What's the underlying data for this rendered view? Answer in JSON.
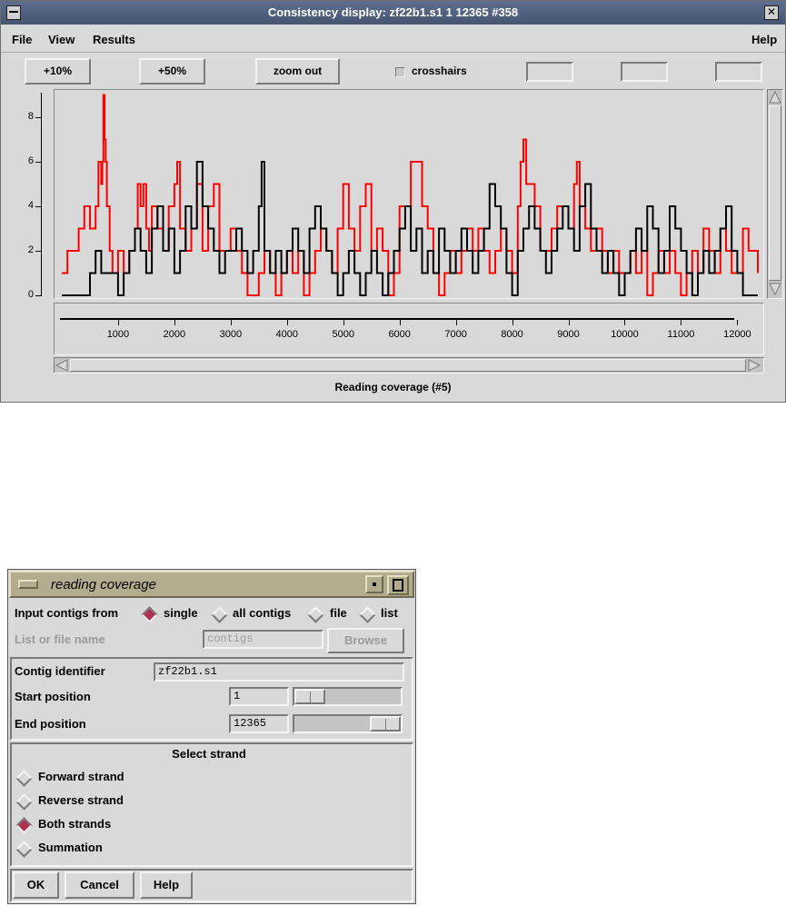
{
  "main": {
    "title": "Consistency display: zf22b1.s1 1 12365 #358",
    "menu": {
      "file": "File",
      "view": "View",
      "results": "Results",
      "help": "Help"
    },
    "toolbar": {
      "zoom10": "+10%",
      "zoom50": "+50%",
      "zoom_out": "zoom out",
      "crosshairs": "crosshairs",
      "crosshairs_checked": false
    },
    "caption": "Reading coverage (#5)"
  },
  "chart_data": {
    "type": "line",
    "title": "Reading coverage (#5)",
    "xlabel": "",
    "ylabel": "",
    "xlim": [
      0,
      12365
    ],
    "ylim": [
      0,
      9
    ],
    "y_ticks": [
      0,
      2,
      4,
      6,
      8
    ],
    "x_ticks": [
      1000,
      2000,
      3000,
      4000,
      5000,
      6000,
      7000,
      8000,
      9000,
      10000,
      11000,
      12000
    ],
    "colors": {
      "forward": "#ff0000",
      "reverse": "#000000"
    },
    "series": [
      {
        "color": "#ff0000",
        "x": [
          0,
          100,
          200,
          300,
          400,
          500,
          600,
          650,
          700,
          720,
          740,
          760,
          780,
          800,
          850,
          900,
          1000,
          1100,
          1200,
          1300,
          1350,
          1400,
          1450,
          1500,
          1550,
          1600,
          1700,
          1800,
          1900,
          2000,
          2050,
          2100,
          2200,
          2300,
          2400,
          2500,
          2600,
          2700,
          2800,
          2900,
          3000,
          3100,
          3200,
          3300,
          3400,
          3500,
          3600,
          3700,
          3800,
          3900,
          4000,
          4100,
          4200,
          4300,
          4400,
          4500,
          4600,
          4700,
          4800,
          4900,
          5000,
          5100,
          5200,
          5300,
          5400,
          5500,
          5600,
          5700,
          5800,
          5900,
          6000,
          6100,
          6200,
          6300,
          6400,
          6500,
          6600,
          6700,
          6800,
          6900,
          7000,
          7100,
          7200,
          7300,
          7400,
          7500,
          7600,
          7700,
          7800,
          7900,
          8000,
          8100,
          8150,
          8200,
          8250,
          8300,
          8400,
          8500,
          8600,
          8700,
          8800,
          8900,
          9000,
          9100,
          9150,
          9200,
          9300,
          9400,
          9500,
          9600,
          9700,
          9800,
          9900,
          10000,
          10100,
          10200,
          10300,
          10400,
          10500,
          10600,
          10700,
          10800,
          10900,
          11000,
          11100,
          11200,
          11300,
          11400,
          11500,
          11600,
          11700,
          11800,
          11900,
          12000,
          12100,
          12200,
          12365
        ],
        "y": [
          1,
          2,
          2,
          3,
          4,
          3,
          4,
          6,
          5,
          6,
          9,
          7,
          6,
          4,
          2,
          1,
          2,
          1,
          2,
          3,
          5,
          4,
          5,
          3,
          2,
          4,
          3,
          2,
          4,
          5,
          6,
          3,
          2,
          3,
          5,
          2,
          4,
          5,
          2,
          2,
          3,
          2,
          1,
          0,
          0,
          1,
          2,
          1,
          0,
          1,
          2,
          1,
          2,
          0,
          1,
          2,
          3,
          2,
          1,
          3,
          5,
          3,
          2,
          4,
          5,
          2,
          3,
          2,
          0,
          1,
          4,
          4,
          6,
          6,
          4,
          3,
          1,
          0,
          1,
          2,
          1,
          2,
          3,
          2,
          3,
          2,
          1,
          2,
          3,
          2,
          1,
          4,
          6,
          7,
          5,
          5,
          4,
          2,
          2,
          3,
          4,
          4,
          3,
          5,
          6,
          4,
          3,
          2,
          3,
          2,
          1,
          2,
          1,
          1,
          2,
          1,
          2,
          0,
          1,
          2,
          1,
          2,
          1,
          0,
          1,
          2,
          1,
          3,
          2,
          1,
          3,
          2,
          1,
          1,
          3,
          2,
          1
        ]
      },
      {
        "color": "#000000",
        "x": [
          0,
          100,
          200,
          300,
          400,
          500,
          600,
          700,
          800,
          900,
          1000,
          1100,
          1200,
          1300,
          1400,
          1500,
          1600,
          1700,
          1800,
          1900,
          2000,
          2100,
          2200,
          2300,
          2400,
          2500,
          2600,
          2700,
          2800,
          2900,
          3000,
          3100,
          3200,
          3300,
          3400,
          3500,
          3550,
          3600,
          3700,
          3800,
          3900,
          4000,
          4100,
          4200,
          4300,
          4400,
          4500,
          4600,
          4700,
          4800,
          4900,
          5000,
          5100,
          5200,
          5300,
          5400,
          5500,
          5600,
          5700,
          5800,
          5900,
          6000,
          6100,
          6200,
          6300,
          6400,
          6500,
          6600,
          6700,
          6800,
          6900,
          7000,
          7100,
          7200,
          7300,
          7400,
          7500,
          7600,
          7700,
          7800,
          7900,
          8000,
          8100,
          8200,
          8300,
          8400,
          8500,
          8600,
          8700,
          8800,
          8900,
          9000,
          9100,
          9200,
          9300,
          9400,
          9500,
          9600,
          9700,
          9800,
          9900,
          10000,
          10100,
          10200,
          10300,
          10400,
          10500,
          10600,
          10700,
          10800,
          10900,
          11000,
          11100,
          11200,
          11300,
          11400,
          11500,
          11600,
          11700,
          11800,
          11900,
          12000,
          12100,
          12200,
          12365
        ],
        "y": [
          0,
          0,
          0,
          0,
          0,
          1,
          2,
          1,
          1,
          1,
          0,
          1,
          2,
          3,
          2,
          1,
          3,
          4,
          2,
          3,
          1,
          2,
          4,
          3,
          6,
          4,
          3,
          2,
          1,
          2,
          2,
          3,
          2,
          1,
          2,
          4,
          6,
          2,
          1,
          2,
          1,
          2,
          3,
          2,
          1,
          3,
          4,
          3,
          2,
          1,
          0,
          1,
          2,
          1,
          0,
          1,
          2,
          1,
          0,
          1,
          2,
          3,
          4,
          2,
          3,
          1,
          2,
          1,
          3,
          2,
          1,
          2,
          3,
          2,
          1,
          2,
          3,
          5,
          4,
          3,
          1,
          0,
          2,
          3,
          4,
          3,
          2,
          1,
          2,
          3,
          4,
          3,
          2,
          4,
          5,
          3,
          2,
          1,
          2,
          1,
          0,
          1,
          2,
          3,
          2,
          4,
          3,
          1,
          2,
          4,
          3,
          2,
          1,
          0,
          1,
          2,
          1,
          2,
          3,
          4,
          2,
          1,
          0,
          0,
          0
        ]
      }
    ]
  },
  "dialog": {
    "title": "reading coverage",
    "input_label": "Input contigs from",
    "options": {
      "single": "single",
      "all": "all contigs",
      "file": "file",
      "list": "list",
      "selected": "single"
    },
    "listfile_label": "List or file name",
    "listfile_value": "contigs",
    "browse": "Browse",
    "contig_label": "Contig identifier",
    "contig_value": "zf22b1.s1",
    "start_label": "Start position",
    "start_value": "1",
    "start_fraction": 0.0,
    "end_label": "End position",
    "end_value": "12365",
    "end_fraction": 1.0,
    "strand_header": "Select strand",
    "strands": [
      "Forward strand",
      "Reverse strand",
      "Both strands",
      "Summation"
    ],
    "strand_selected": "Both strands",
    "ok": "OK",
    "cancel": "Cancel",
    "help": "Help"
  }
}
